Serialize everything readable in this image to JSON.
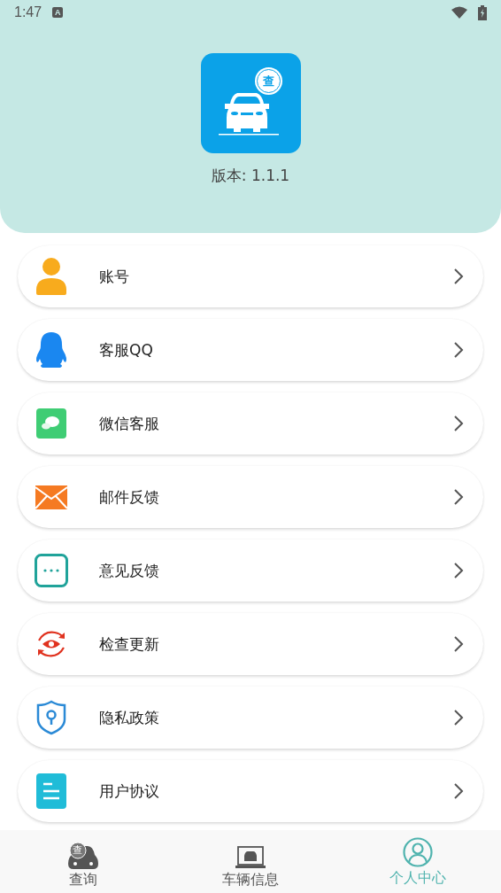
{
  "status_bar": {
    "time": "1:47",
    "notification": "A"
  },
  "header": {
    "app_icon_badge": "查",
    "version": "版本: 1.1.1"
  },
  "menu": [
    {
      "kind": "account",
      "label": "账号"
    },
    {
      "kind": "qq",
      "label": "客服QQ"
    },
    {
      "kind": "wechat",
      "label": "微信客服"
    },
    {
      "kind": "mail",
      "label": "邮件反馈"
    },
    {
      "kind": "feedback",
      "label": "意见反馈"
    },
    {
      "kind": "update",
      "label": "检查更新"
    },
    {
      "kind": "privacy",
      "label": "隐私政策"
    },
    {
      "kind": "agreement",
      "label": "用户协议"
    }
  ],
  "tabs": [
    {
      "kind": "query",
      "label": "查询",
      "badge": "查",
      "selected": false
    },
    {
      "kind": "vehicle",
      "label": "车辆信息",
      "selected": false
    },
    {
      "kind": "profile",
      "label": "个人中心",
      "selected": true
    }
  ]
}
